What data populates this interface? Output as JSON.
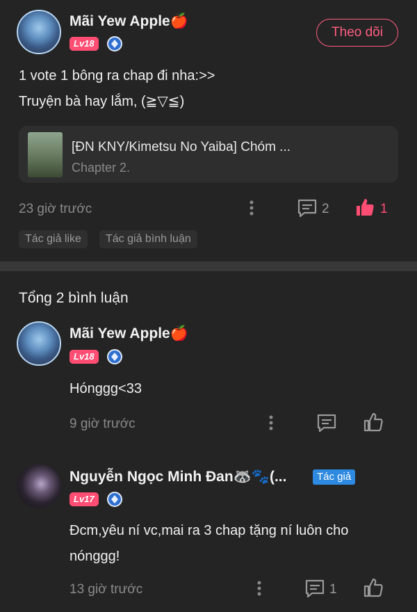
{
  "post": {
    "author_name": "Mãi Yew Apple🍎",
    "level": "Lv18",
    "follow_label": "Theo dõi",
    "content_lines": [
      "1 vote 1 bông ra chap đi nha:>>",
      "Truyện bà hay lắm, (≧▽≦)"
    ],
    "story_title": "[ĐN KNY/Kimetsu No Yaiba] Chóm ...",
    "story_chapter": "Chapter 2.",
    "time": "23 giờ trước",
    "comment_count": "2",
    "like_count": "1",
    "tags": [
      "Tác giả like",
      "Tác giả bình luận"
    ]
  },
  "comments_header": "Tổng 2 bình luận",
  "comments": [
    {
      "author_name": "Mãi Yew Apple🍎",
      "level": "Lv18",
      "text_lines": [
        "Hónggg<33"
      ],
      "time": "9 giờ trước"
    },
    {
      "author_name": "Nguyễn Ngọc Minh Đan🦝🐾(...",
      "author_badge": "Tác giả",
      "level": "Lv17",
      "text_lines": [
        "Đcm,yêu ní vc,mai ra 3 chap tặng ní luôn cho",
        "nónggg!"
      ],
      "time": "13 giờ trước",
      "reply_count": "1"
    }
  ],
  "colors": {
    "background": "#242424",
    "accent": "#ff4d73",
    "muted": "#8a8a8a",
    "author_badge": "#2d8ae0"
  }
}
